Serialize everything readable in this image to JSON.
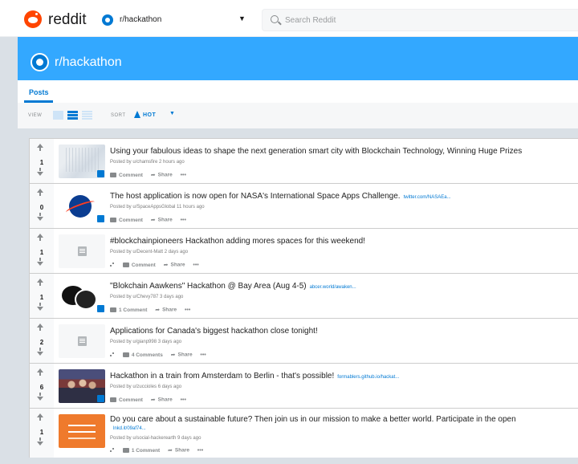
{
  "header": {
    "brand": "reddit",
    "subreddit_selector": "r/hackathon",
    "search_placeholder": "Search Reddit"
  },
  "banner": {
    "title": "r/hackathon"
  },
  "tabs": [
    {
      "label": "Posts"
    }
  ],
  "sortbar": {
    "view_label": "VIEW",
    "sort_label": "SORT",
    "sort_value": "HOT"
  },
  "colors": {
    "accent": "#0079d3",
    "brand": "#ff4500",
    "banner": "#33a8ff"
  },
  "posts": [
    {
      "score": "1",
      "title": "Using your fabulous ideas to shape the next generation smart city with Blockchain Technology, Winning Huge Prizes",
      "domain": "",
      "meta": "Posted by u/chamsfire 2 hours ago",
      "comments": "Comment",
      "share": "Share",
      "thumbnail": "city-blueprint"
    },
    {
      "score": "0",
      "title": "The host application is now open for NASA's International Space Apps Challenge.",
      "domain": "twitter.com/NASAEa...",
      "meta": "Posted by u/SpaceAppsGlobal 11 hours ago",
      "comments": "Comment",
      "share": "Share",
      "thumbnail": "nasa-logo"
    },
    {
      "score": "1",
      "title": "#blockchainpioneers Hackathon adding mores spaces for this weekend!",
      "domain": "",
      "meta": "Posted by u/Decent-Matt 2 days ago",
      "comments": "Comment",
      "share": "Share",
      "thumbnail": "text-post"
    },
    {
      "score": "1",
      "title": "\"Blokchain Aawkens\" Hackathon @ Bay Area (Aug 4-5)",
      "domain": "abcer.world/awaken...",
      "meta": "Posted by u/Chevy787 3 days ago",
      "comments": "1 Comment",
      "share": "Share",
      "thumbnail": "chat-bubbles"
    },
    {
      "score": "2",
      "title": "Applications for Canada's biggest hackathon close tonight!",
      "domain": "",
      "meta": "Posted by u/gianp998 3 days ago",
      "comments": "4 Comments",
      "share": "Share",
      "thumbnail": "text-post"
    },
    {
      "score": "6",
      "title": "Hackathon in a train from Amsterdam to Berlin - that's possible!",
      "domain": "formablers.github.io/hackat...",
      "meta": "Posted by u/zuccioles 6 days ago",
      "comments": "Comment",
      "share": "Share",
      "thumbnail": "group-photo"
    },
    {
      "score": "1",
      "title": "Do you care about a sustainable future? Then join us in our mission to make a better world. Participate in the open",
      "domain": "lnkd.it/09af74...",
      "meta": "Posted by u/social-hackerearth 9 days ago",
      "comments": "1 Comment",
      "share": "Share",
      "thumbnail": "orange-banner"
    }
  ]
}
